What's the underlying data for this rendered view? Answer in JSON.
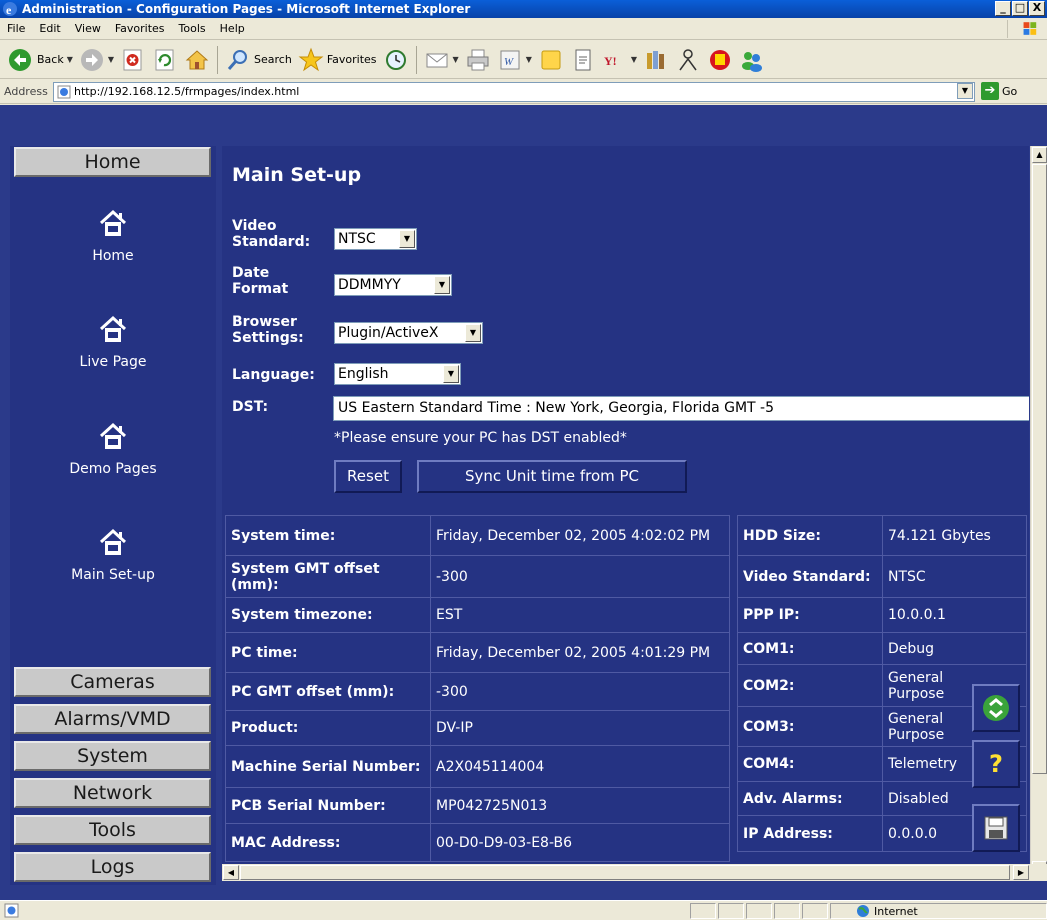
{
  "window": {
    "title": "Administration - Configuration Pages - Microsoft Internet Explorer",
    "controls": [
      "_",
      "□",
      "X"
    ]
  },
  "menu": [
    "File",
    "Edit",
    "View",
    "Favorites",
    "Tools",
    "Help"
  ],
  "toolbar": {
    "back_label": "Back",
    "search_label": "Search",
    "favorites_label": "Favorites"
  },
  "address": {
    "label": "Address",
    "url": "http://192.168.12.5/frmpages/index.html",
    "go_label": "Go"
  },
  "nav": {
    "home_header": "Home",
    "links": [
      "Home",
      "Live Page",
      "Demo Pages",
      "Main Set-up"
    ],
    "sections": [
      "Cameras",
      "Alarms/VMD",
      "System",
      "Network",
      "Tools",
      "Logs"
    ]
  },
  "main": {
    "title": "Main Set-up",
    "video_standard_label": "Video Standard:",
    "video_standard_value": "NTSC",
    "date_format_label": "Date Format",
    "date_format_value": "DDMMYY",
    "browser_settings_label": "Browser Settings:",
    "browser_settings_value": "Plugin/ActiveX",
    "language_label": "Language:",
    "language_value": "English",
    "dst_label": "DST:",
    "dst_value": "US Eastern Standard Time : New York, Georgia, Florida GMT -5",
    "dst_note": "*Please ensure your PC has DST enabled*",
    "reset_button": "Reset",
    "sync_button": "Sync Unit time from PC"
  },
  "system_info": [
    {
      "key": "System time:",
      "value": "Friday, December 02, 2005 4:02:02 PM"
    },
    {
      "key": "System GMT offset (mm):",
      "value": "-300"
    },
    {
      "key": "System timezone:",
      "value": "EST"
    },
    {
      "key": "PC time:",
      "value": "Friday, December 02, 2005 4:01:29 PM"
    },
    {
      "key": "PC GMT offset (mm):",
      "value": "-300"
    },
    {
      "key": "Product:",
      "value": "DV-IP"
    },
    {
      "key": "Machine Serial Number:",
      "value": "A2X045114004"
    },
    {
      "key": "PCB Serial Number:",
      "value": "MP042725N013"
    },
    {
      "key": "MAC Address:",
      "value": "00-D0-D9-03-E8-B6"
    }
  ],
  "unit_info": [
    {
      "key": "HDD Size:",
      "value": "74.121 Gbytes"
    },
    {
      "key": "Video Standard:",
      "value": "NTSC"
    },
    {
      "key": "PPP IP:",
      "value": "10.0.0.1"
    },
    {
      "key": "COM1:",
      "value": "Debug"
    },
    {
      "key": "COM2:",
      "value": "General Purpose"
    },
    {
      "key": "COM3:",
      "value": "General Purpose"
    },
    {
      "key": "COM4:",
      "value": "Telemetry"
    },
    {
      "key": "Adv. Alarms:",
      "value": "Disabled"
    },
    {
      "key": "IP Address:",
      "value": "0.0.0.0"
    }
  ],
  "status": {
    "text": "",
    "zone": "Internet"
  },
  "colors": {
    "frame_bg": "#253383",
    "xp_chrome": "#ece9d8",
    "title_blue": "#0842a8"
  }
}
